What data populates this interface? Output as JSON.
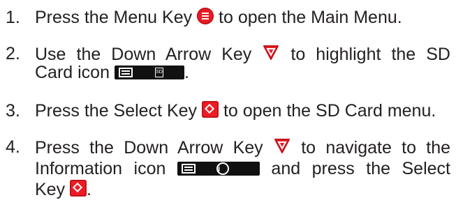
{
  "steps": [
    {
      "num": "1.",
      "a": "Press the Menu Key",
      "b": "to open the Main Menu."
    },
    {
      "num": "2.",
      "a": "Use the Down Arrow Key",
      "b": "to highlight the SD",
      "c": "Card icon",
      "d": "."
    },
    {
      "num": "3.",
      "a": "Press the Select Key",
      "b": "to open the SD Card menu."
    },
    {
      "num": "4.",
      "a": "Press the Down Arrow Key",
      "b": "to navigate to the",
      "c": "Information icon",
      "d": "and press the Select",
      "e": "Key",
      "f": "."
    }
  ],
  "icons": {
    "sd_label": "SD",
    "info_label": "i"
  }
}
